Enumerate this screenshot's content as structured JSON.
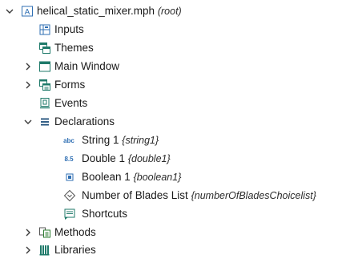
{
  "tree": {
    "root": {
      "name": "helical_static_mixer.mph",
      "tag": "(root)",
      "expanded": true,
      "icon": "application-icon"
    },
    "items": [
      {
        "id": "inputs",
        "label": "Inputs",
        "icon": "inputs-icon"
      },
      {
        "id": "themes",
        "label": "Themes",
        "icon": "themes-icon"
      },
      {
        "id": "main-window",
        "label": "Main Window",
        "icon": "window-icon",
        "collapsed": true
      },
      {
        "id": "forms",
        "label": "Forms",
        "icon": "forms-icon",
        "collapsed": true
      },
      {
        "id": "events",
        "label": "Events",
        "icon": "events-icon"
      },
      {
        "id": "declarations",
        "label": "Declarations",
        "icon": "declarations-icon",
        "expanded": true,
        "children": [
          {
            "id": "string1",
            "label": "String 1",
            "tag": "{string1}",
            "icon": "string-icon",
            "icon_text": "abc"
          },
          {
            "id": "double1",
            "label": "Double 1",
            "tag": "{double1}",
            "icon": "double-icon",
            "icon_text": "8.5"
          },
          {
            "id": "boolean1",
            "label": "Boolean 1",
            "tag": "{boolean1}",
            "icon": "boolean-icon"
          },
          {
            "id": "blades-list",
            "label": "Number of Blades List",
            "tag": "{numberOfBladesChoicelist}",
            "icon": "choice-list-icon"
          }
        ]
      },
      {
        "id": "shortcuts",
        "label": "Shortcuts",
        "icon": "shortcuts-icon"
      },
      {
        "id": "methods",
        "label": "Methods",
        "icon": "methods-icon",
        "collapsed": true
      },
      {
        "id": "libraries",
        "label": "Libraries",
        "icon": "libraries-icon",
        "collapsed": true
      }
    ]
  },
  "colors": {
    "icon_blue": "#2f6fb3",
    "icon_teal": "#1f7a6a",
    "icon_green": "#2e7d32",
    "chevron": "#3a3a3a"
  }
}
